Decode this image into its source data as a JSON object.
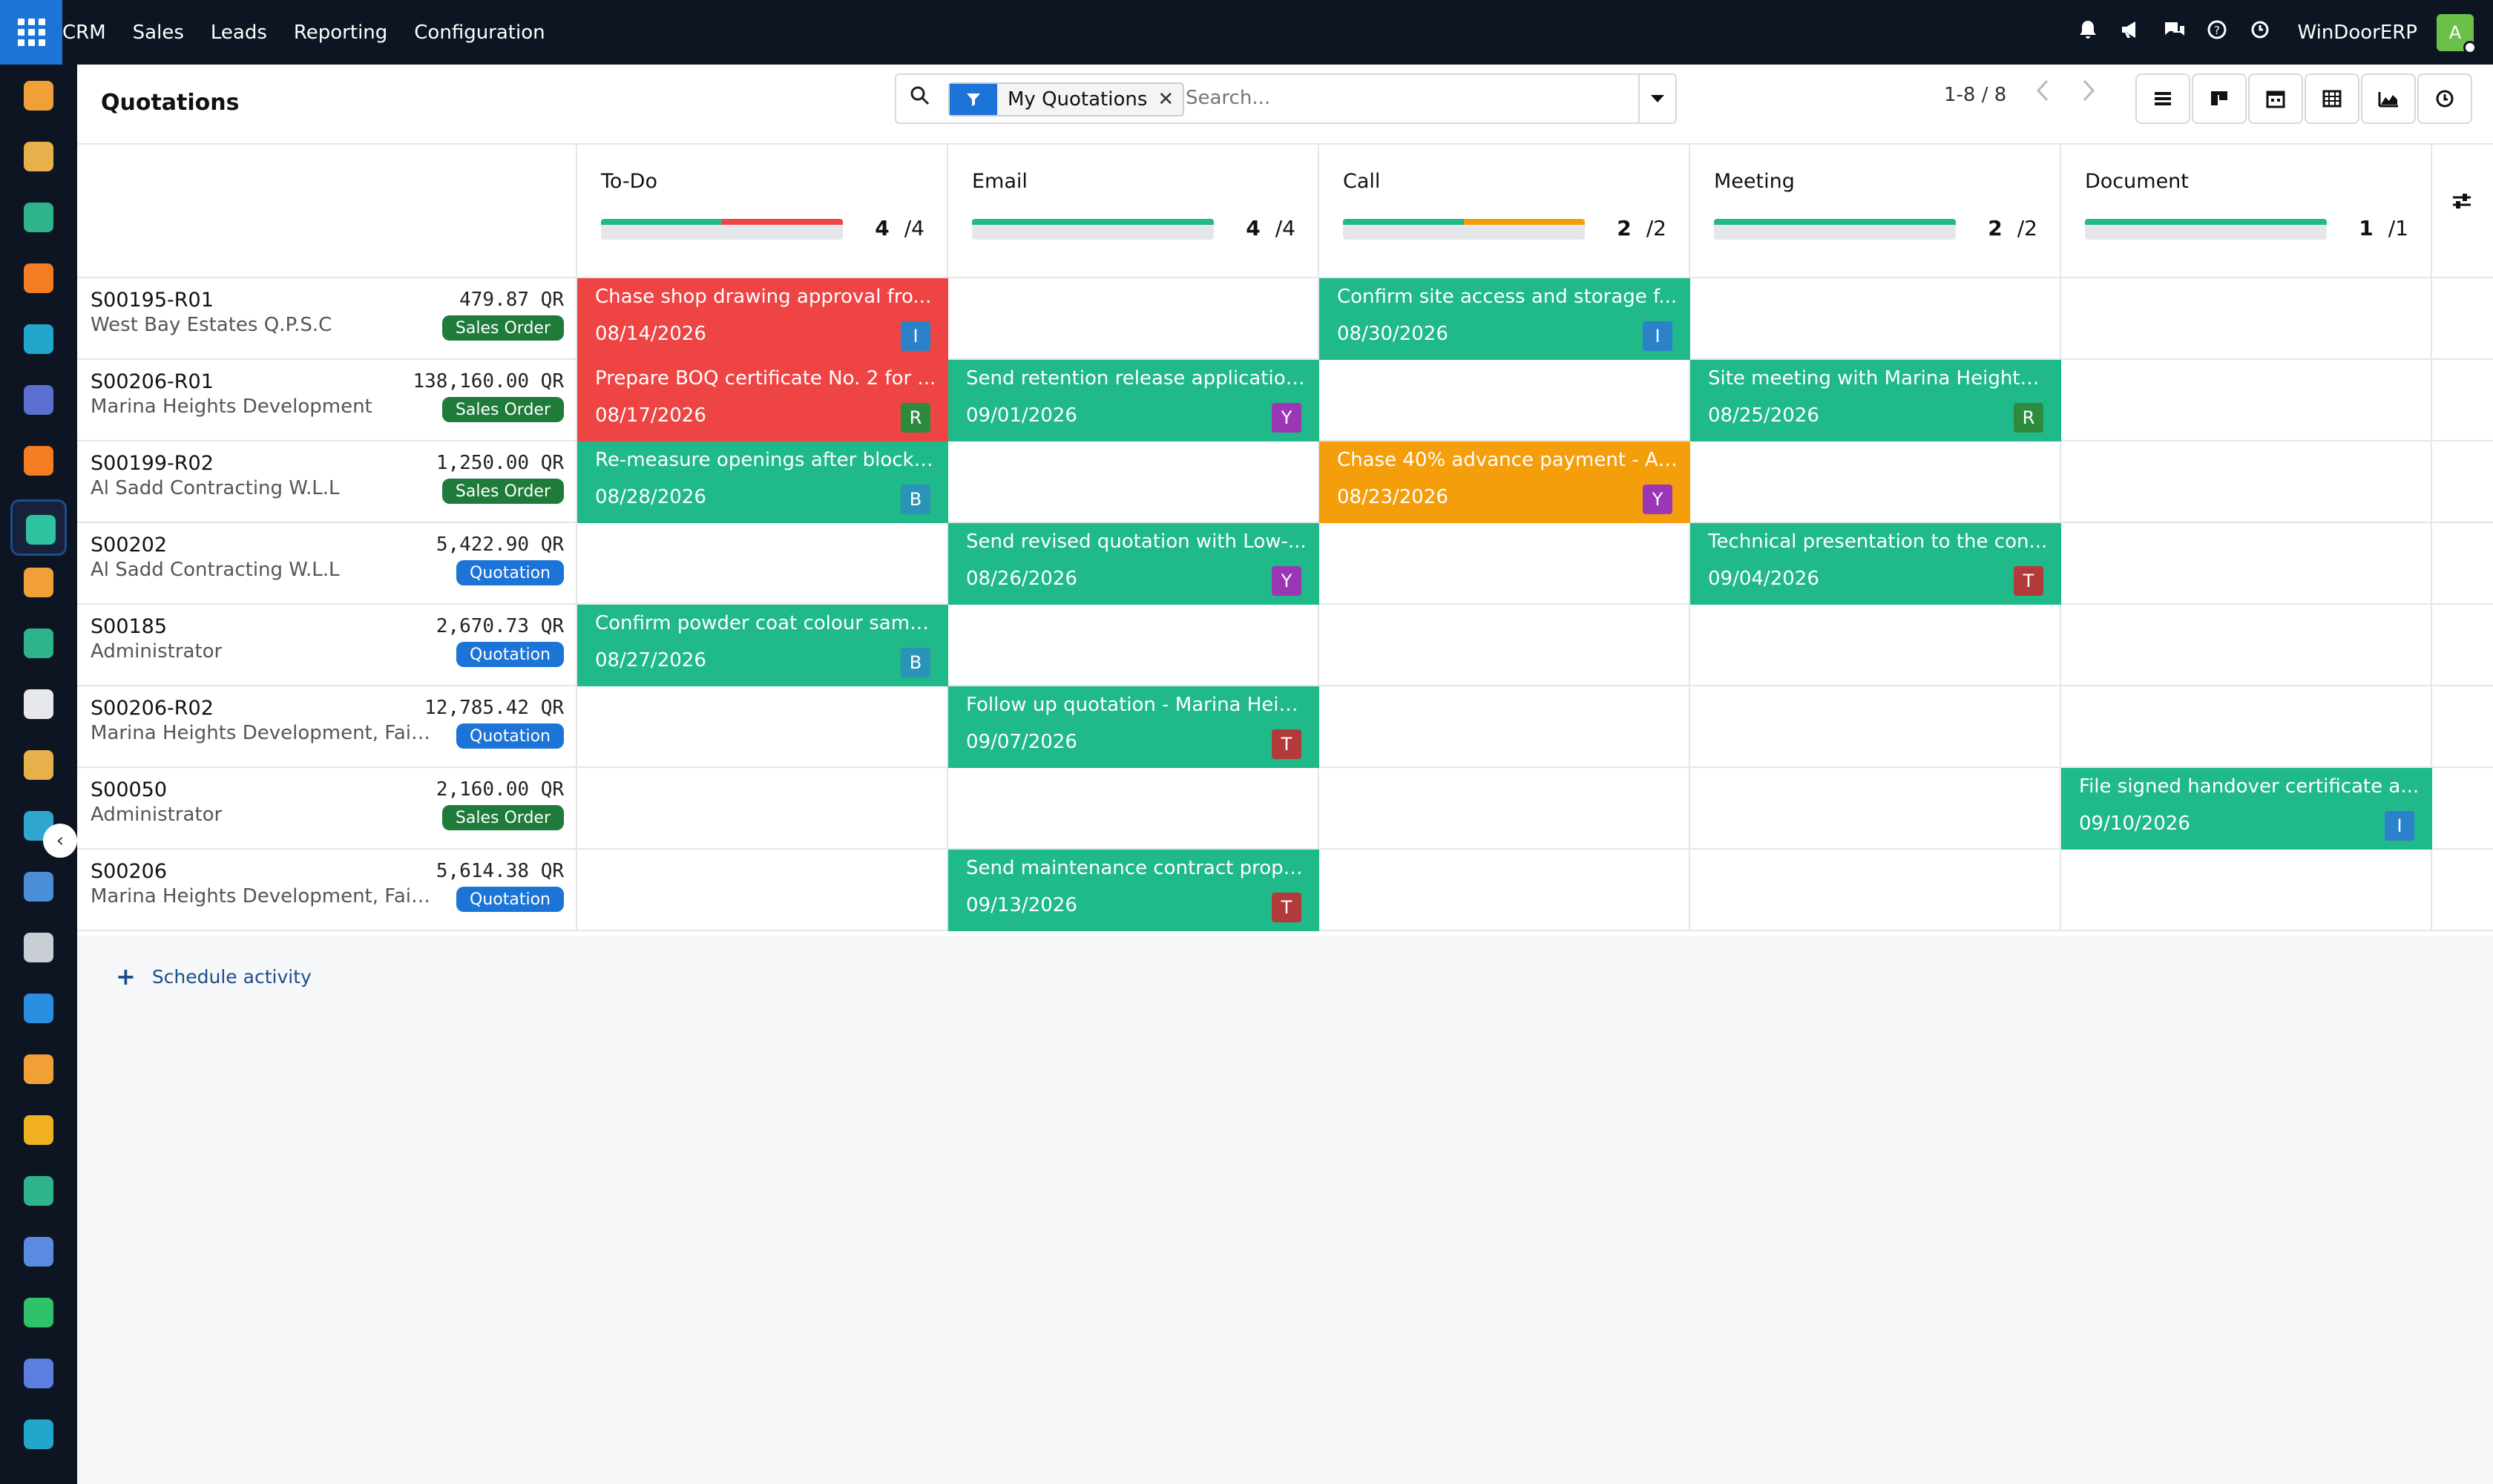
{
  "topbar": {
    "menu": [
      "CRM",
      "Sales",
      "Leads",
      "Reporting",
      "Configuration"
    ],
    "company": "WinDoorERP",
    "user_initial": "A"
  },
  "sidebar": {
    "apps": [
      {
        "icon": "dashboards-icon",
        "color": "#f0a037"
      },
      {
        "icon": "documents-icon",
        "color": "#e8b04a"
      },
      {
        "icon": "contacts-icon",
        "color": "#2fb38b"
      },
      {
        "icon": "discuss-icon",
        "color": "#f47c21"
      },
      {
        "icon": "website-icon",
        "color": "#22a6cc"
      },
      {
        "icon": "email-marketing-icon",
        "color": "#5a6fd0"
      },
      {
        "icon": "livechat-icon",
        "color": "#f47c21"
      },
      {
        "icon": "crm-icon",
        "color": "#2fc2a0"
      },
      {
        "icon": "reporting-icon",
        "color": "#f0a037"
      },
      {
        "icon": "employees-icon",
        "color": "#2fb38b"
      },
      {
        "icon": "inventory-icon",
        "color": "#e6e8ec"
      },
      {
        "icon": "project-icon",
        "color": "#e8b04a"
      },
      {
        "icon": "todo-icon",
        "color": "#2fa6d0"
      },
      {
        "icon": "knowledge-icon",
        "color": "#4a8ed8"
      },
      {
        "icon": "purchase-icon",
        "color": "#c9cdd4"
      },
      {
        "icon": "invoicing-icon",
        "color": "#2a8ee0"
      },
      {
        "icon": "team-icon",
        "color": "#f0a037"
      },
      {
        "icon": "calendar-icon",
        "color": "#f0b020"
      },
      {
        "icon": "sign-icon",
        "color": "#2fb38b"
      },
      {
        "icon": "apps-icon",
        "color": "#5a8be0"
      },
      {
        "icon": "whatsapp-icon",
        "color": "#2fc26a"
      },
      {
        "icon": "timer-icon",
        "color": "#5a7fe0"
      },
      {
        "icon": "website-alt-icon",
        "color": "#22a6cc"
      }
    ]
  },
  "control": {
    "title": "Quotations",
    "facet": "My Quotations",
    "search_placeholder": "Search...",
    "pager": "1-8 / 8"
  },
  "columns": [
    {
      "title": "To-Do",
      "done": "4",
      "total": "/4",
      "segments": [
        {
          "color": "#1fb98a",
          "frac": 0.5
        },
        {
          "color": "#ef4444",
          "frac": 0.5
        }
      ]
    },
    {
      "title": "Email",
      "done": "4",
      "total": "/4",
      "segments": [
        {
          "color": "#1fb98a",
          "frac": 1.0
        }
      ]
    },
    {
      "title": "Call",
      "done": "2",
      "total": "/2",
      "segments": [
        {
          "color": "#1fb98a",
          "frac": 0.5
        },
        {
          "color": "#f59e0b",
          "frac": 0.5
        }
      ]
    },
    {
      "title": "Meeting",
      "done": "2",
      "total": "/2",
      "segments": [
        {
          "color": "#1fb98a",
          "frac": 1.0
        }
      ]
    },
    {
      "title": "Document",
      "done": "1",
      "total": "/1",
      "segments": [
        {
          "color": "#1fb98a",
          "frac": 1.0
        }
      ]
    }
  ],
  "rows": [
    {
      "ref": "S00195-R01",
      "amount": "479.87 QR",
      "customer": "West Bay Estates Q.P.S.C",
      "state": "Sales Order",
      "acts": [
        {
          "col": 0,
          "title": "Chase shop drawing approval fro...",
          "date": "08/14/2026",
          "user": "I",
          "color": "#ef4444",
          "ucolor": "#2b82c9"
        },
        {
          "col": 2,
          "title": "Confirm site access and storage f...",
          "date": "08/30/2026",
          "user": "I",
          "color": "#1fb98a",
          "ucolor": "#2b82c9"
        }
      ]
    },
    {
      "ref": "S00206-R01",
      "amount": "138,160.00 QR",
      "customer": "Marina Heights Development",
      "state": "Sales Order",
      "acts": [
        {
          "col": 0,
          "title": "Prepare BOQ certificate No. 2 for ...",
          "date": "08/17/2026",
          "user": "R",
          "color": "#ef4444",
          "ucolor": "#2e8b3e"
        },
        {
          "col": 1,
          "title": "Send retention release application...",
          "date": "09/01/2026",
          "user": "Y",
          "color": "#1fb98a",
          "ucolor": "#9b37b5"
        },
        {
          "col": 3,
          "title": "Site meeting with Marina Heights ...",
          "date": "08/25/2026",
          "user": "R",
          "color": "#1fb98a",
          "ucolor": "#2e8b3e"
        }
      ]
    },
    {
      "ref": "S00199-R02",
      "amount": "1,250.00 QR",
      "customer": "Al Sadd Contracting W.L.L",
      "state": "Sales Order",
      "acts": [
        {
          "col": 0,
          "title": "Re-measure openings after block ...",
          "date": "08/28/2026",
          "user": "B",
          "color": "#1fb98a",
          "ucolor": "#2a93b8"
        },
        {
          "col": 2,
          "title": "Chase 40% advance payment - Al...",
          "date": "08/23/2026",
          "user": "Y",
          "color": "#f59e0b",
          "ucolor": "#9b37b5"
        }
      ]
    },
    {
      "ref": "S00202",
      "amount": "5,422.90 QR",
      "customer": "Al Sadd Contracting W.L.L",
      "state": "Quotation",
      "acts": [
        {
          "col": 1,
          "title": "Send revised quotation with Low-...",
          "date": "08/26/2026",
          "user": "Y",
          "color": "#1fb98a",
          "ucolor": "#9b37b5"
        },
        {
          "col": 3,
          "title": "Technical presentation to the con...",
          "date": "09/04/2026",
          "user": "T",
          "color": "#1fb98a",
          "ucolor": "#b33a3a"
        }
      ]
    },
    {
      "ref": "S00185",
      "amount": "2,670.73 QR",
      "customer": "Administrator",
      "state": "Quotation",
      "acts": [
        {
          "col": 0,
          "title": "Confirm powder coat colour samp...",
          "date": "08/27/2026",
          "user": "B",
          "color": "#1fb98a",
          "ucolor": "#2a93b8"
        }
      ]
    },
    {
      "ref": "S00206-R02",
      "amount": "12,785.42 QR",
      "customer": "Marina Heights Development, Faisal ...",
      "state": "Quotation",
      "acts": [
        {
          "col": 1,
          "title": "Follow up quotation - Marina Heig...",
          "date": "09/07/2026",
          "user": "T",
          "color": "#1fb98a",
          "ucolor": "#b33a3a"
        }
      ]
    },
    {
      "ref": "S00050",
      "amount": "2,160.00 QR",
      "customer": "Administrator",
      "state": "Sales Order",
      "acts": [
        {
          "col": 4,
          "title": "File signed handover certificate a...",
          "date": "09/10/2026",
          "user": "I",
          "color": "#1fb98a",
          "ucolor": "#2b82c9"
        }
      ]
    },
    {
      "ref": "S00206",
      "amount": "5,614.38 QR",
      "customer": "Marina Heights Development, Faisal ...",
      "state": "Quotation",
      "acts": [
        {
          "col": 1,
          "title": "Send maintenance contract propo...",
          "date": "09/13/2026",
          "user": "T",
          "color": "#1fb98a",
          "ucolor": "#b33a3a"
        }
      ]
    }
  ],
  "state_colors": {
    "Sales Order": "#1e7b3a",
    "Quotation": "#1c74d6"
  },
  "schedule_label": "Schedule activity"
}
